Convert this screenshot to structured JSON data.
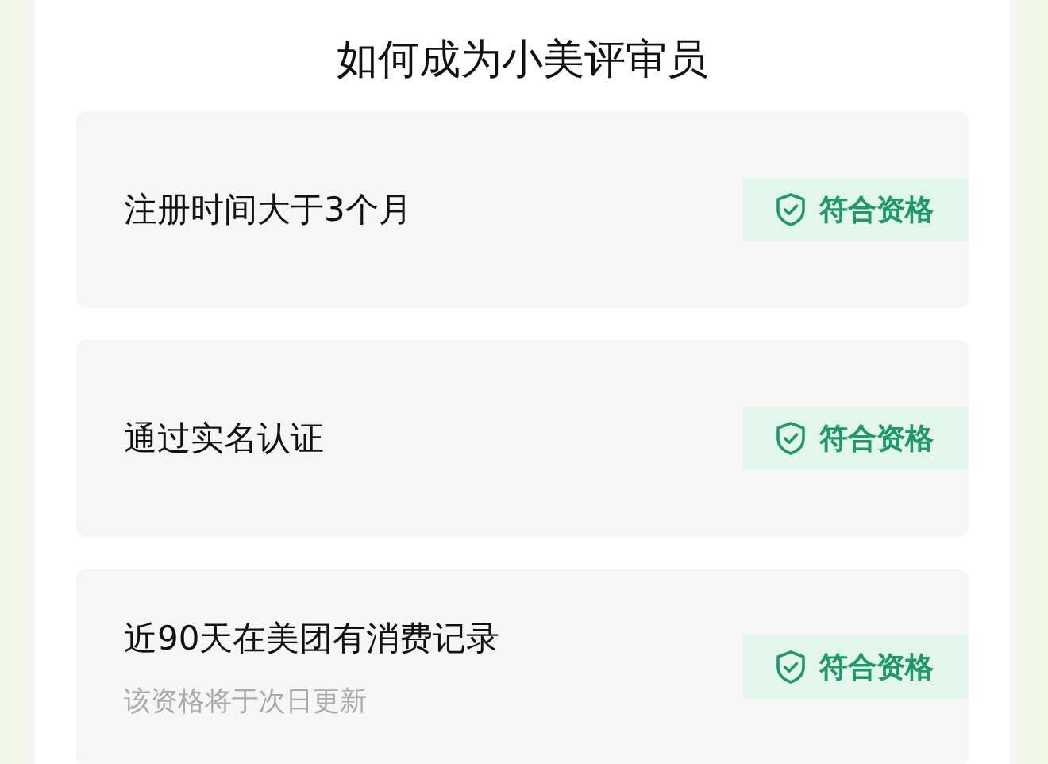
{
  "title": "如何成为小美评审员",
  "requirements": [
    {
      "label": "注册时间大于3个月",
      "badge": "符合资格"
    },
    {
      "label": "通过实名认证",
      "badge": "符合资格"
    },
    {
      "label": "近90天在美团有消费记录",
      "note": "该资格将于次日更新",
      "badge": "符合资格"
    }
  ]
}
